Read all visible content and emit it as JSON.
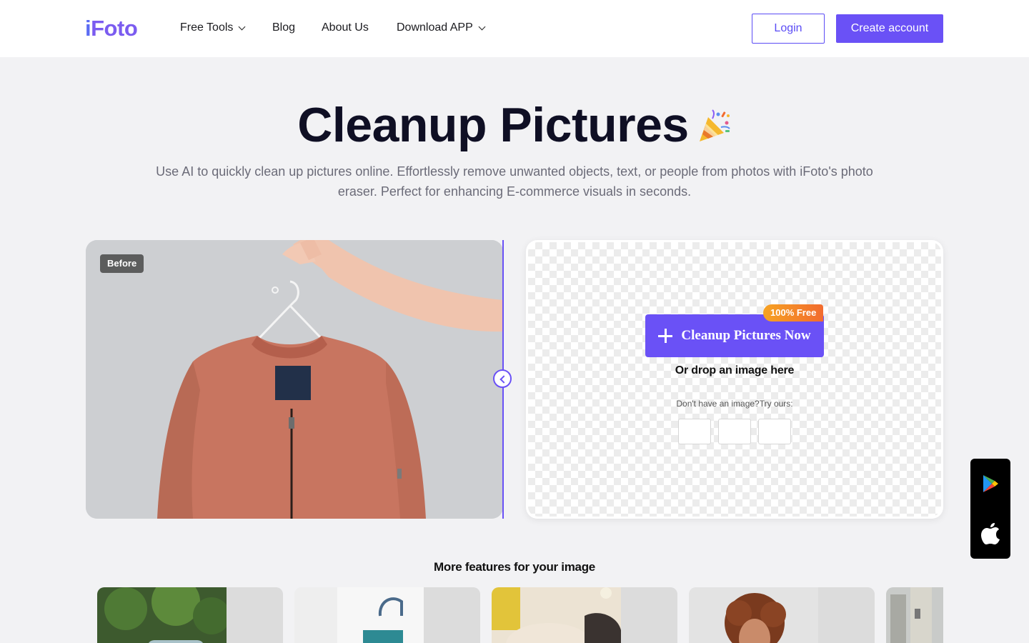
{
  "brand": {
    "logo_text_a": "i",
    "logo_text_b": "Foto"
  },
  "nav": {
    "free_tools": "Free Tools",
    "blog": "Blog",
    "about": "About Us",
    "download": "Download APP"
  },
  "auth": {
    "login": "Login",
    "create": "Create account"
  },
  "hero": {
    "title": "Cleanup Pictures",
    "subtitle": "Use AI to quickly clean up pictures online. Effortlessly remove unwanted objects, text, or people from photos with iFoto's photo eraser. Perfect for enhancing E-commerce visuals in seconds."
  },
  "compare": {
    "before_label": "Before"
  },
  "upload": {
    "button_label": "Cleanup Pictures Now",
    "free_badge": "100% Free",
    "drop_text": "Or drop an image here",
    "try_text": "Don't have an image?Try ours:"
  },
  "features": {
    "title": "More features for your image"
  },
  "colors": {
    "accent": "#6a51f6",
    "badge_orange": "#f26b2e",
    "title": "#0f0f24"
  },
  "icons": [
    "chevron-down-icon",
    "party-popper-icon",
    "plus-icon",
    "google-play-icon",
    "apple-icon"
  ]
}
